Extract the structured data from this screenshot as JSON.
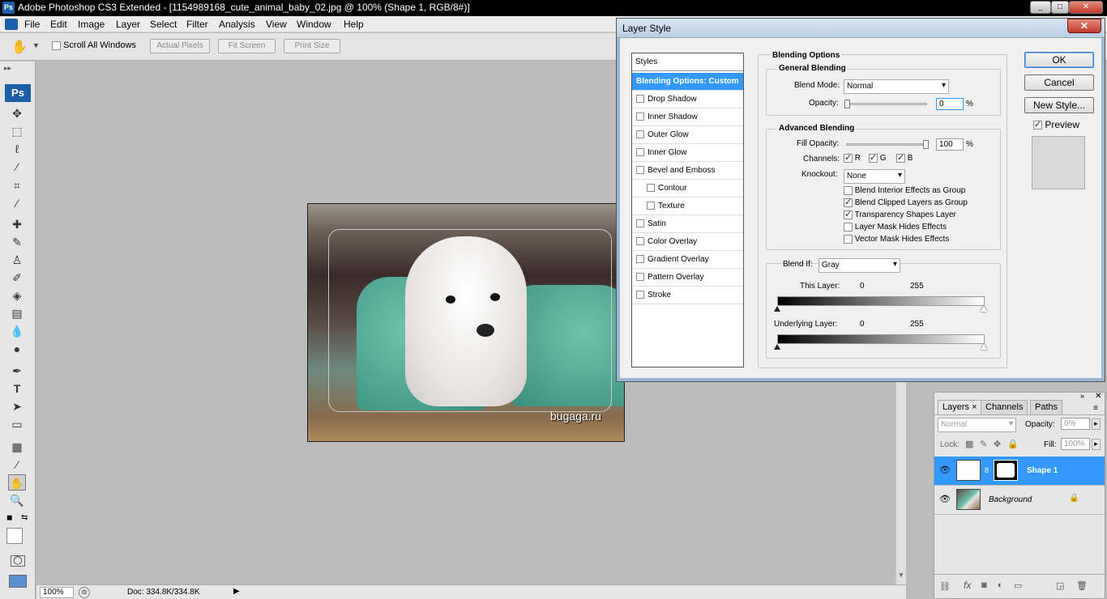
{
  "app": {
    "title": "Adobe Photoshop CS3 Extended - [1154989168_cute_animal_baby_02.jpg @ 100% (Shape 1, RGB/8#)]",
    "logo": "Ps",
    "window_buttons": [
      "_",
      "□",
      "✕"
    ]
  },
  "menu": [
    "File",
    "Edit",
    "Image",
    "Layer",
    "Select",
    "Filter",
    "Analysis",
    "View",
    "Window",
    "Help"
  ],
  "options": {
    "scroll_all_windows": "Scroll All Windows",
    "actual_pixels": "Actual Pixels",
    "fit_screen": "Fit Screen",
    "print_size": "Print Size"
  },
  "toolbox": {
    "ps_label": "Ps",
    "tools": [
      "move-tool",
      "marquee-tool",
      "lasso-tool",
      "magic-wand-tool",
      "crop-tool",
      "slice-tool",
      "healing-brush-tool",
      "brush-tool",
      "clone-stamp-tool",
      "history-brush-tool",
      "eraser-tool",
      "gradient-tool",
      "blur-tool",
      "dodge-tool",
      "pen-tool",
      "type-tool",
      "path-selection-tool",
      "shape-tool",
      "notes-tool",
      "eyedropper-tool",
      "hand-tool",
      "zoom-tool"
    ]
  },
  "document": {
    "watermark": "bugaga.ru"
  },
  "status": {
    "zoom": "100%",
    "doc": "Doc: 334.8K/334.8K"
  },
  "dialog": {
    "title": "Layer Style",
    "styles_header": "Styles",
    "styles": [
      {
        "label": "Blending Options: Custom",
        "checkbox": false,
        "selected": true,
        "indent": false
      },
      {
        "label": "Drop Shadow",
        "checkbox": true,
        "selected": false,
        "indent": false
      },
      {
        "label": "Inner Shadow",
        "checkbox": true,
        "selected": false,
        "indent": false
      },
      {
        "label": "Outer Glow",
        "checkbox": true,
        "selected": false,
        "indent": false
      },
      {
        "label": "Inner Glow",
        "checkbox": true,
        "selected": false,
        "indent": false
      },
      {
        "label": "Bevel and Emboss",
        "checkbox": true,
        "selected": false,
        "indent": false
      },
      {
        "label": "Contour",
        "checkbox": true,
        "selected": false,
        "indent": true
      },
      {
        "label": "Texture",
        "checkbox": true,
        "selected": false,
        "indent": true
      },
      {
        "label": "Satin",
        "checkbox": true,
        "selected": false,
        "indent": false
      },
      {
        "label": "Color Overlay",
        "checkbox": true,
        "selected": false,
        "indent": false
      },
      {
        "label": "Gradient Overlay",
        "checkbox": true,
        "selected": false,
        "indent": false
      },
      {
        "label": "Pattern Overlay",
        "checkbox": true,
        "selected": false,
        "indent": false
      },
      {
        "label": "Stroke",
        "checkbox": true,
        "selected": false,
        "indent": false
      }
    ],
    "blending_options": "Blending Options",
    "general_blending": "General Blending",
    "blend_mode_label": "Blend Mode:",
    "blend_mode_value": "Normal",
    "opacity_label": "Opacity:",
    "opacity_value": "0",
    "percent": "%",
    "advanced_blending": "Advanced Blending",
    "fill_opacity_label": "Fill Opacity:",
    "fill_opacity_value": "100",
    "channels_label": "Channels:",
    "channel_r": "R",
    "channel_g": "G",
    "channel_b": "B",
    "knockout_label": "Knockout:",
    "knockout_value": "None",
    "adv_options": [
      {
        "label": "Blend Interior Effects as Group",
        "checked": false
      },
      {
        "label": "Blend Clipped Layers as Group",
        "checked": true
      },
      {
        "label": "Transparency Shapes Layer",
        "checked": true
      },
      {
        "label": "Layer Mask Hides Effects",
        "checked": false
      },
      {
        "label": "Vector Mask Hides Effects",
        "checked": false
      }
    ],
    "blend_if_label": "Blend If:",
    "blend_if_value": "Gray",
    "this_layer_label": "This Layer:",
    "this_layer_min": "0",
    "this_layer_max": "255",
    "underlying_layer_label": "Underlying Layer:",
    "underlying_min": "0",
    "underlying_max": "255",
    "ok": "OK",
    "cancel": "Cancel",
    "new_style": "New Style...",
    "preview": "Preview"
  },
  "layers_panel": {
    "tabs": [
      "Layers",
      "Channels",
      "Paths"
    ],
    "blend_mode": "Normal",
    "opacity_label": "Opacity:",
    "opacity_value": "0%",
    "lock_label": "Lock:",
    "fill_label": "Fill:",
    "fill_value": "100%",
    "layers": [
      {
        "name": "Shape 1",
        "selected": true
      },
      {
        "name": "Background",
        "selected": false
      }
    ]
  }
}
